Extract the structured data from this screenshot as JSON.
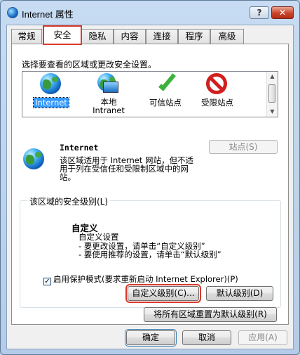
{
  "window": {
    "title": "Internet 属性"
  },
  "titlebar": {
    "help_label": "?",
    "close_label": "✕"
  },
  "tabs": [
    {
      "label": "常规"
    },
    {
      "label": "安全"
    },
    {
      "label": "隐私"
    },
    {
      "label": "内容"
    },
    {
      "label": "连接"
    },
    {
      "label": "程序"
    },
    {
      "label": "高级"
    }
  ],
  "active_tab": "安全",
  "security": {
    "instruction": "选择要查看的区域或更改安全设置。",
    "zones": [
      {
        "label": "Internet",
        "label2": "",
        "icon": "globe-icon",
        "selected": true
      },
      {
        "label": "本地",
        "label2": "Intranet",
        "icon": "local-intranet-icon",
        "selected": false
      },
      {
        "label": "可信站点",
        "label2": "",
        "icon": "checkmark-icon",
        "selected": false
      },
      {
        "label": "受限站点",
        "label2": "",
        "icon": "no-entry-icon",
        "selected": false
      }
    ],
    "zone_name": "Internet",
    "zone_description": "该区域适用于 Internet 网站，但不适用于列在受信任和受限制区域中的网站。",
    "sites_button": "站点(S)",
    "group_title": "该区域的安全级别(L)",
    "level_name": "自定义",
    "level_lines": [
      "自定义设置",
      "- 要更改设置，请单击“自定义级别”",
      "- 要使用推荐的设置，请单击“默认级别”"
    ],
    "protected_mode_label": "启用保护模式(要求重新启动 Internet Explorer)(P)",
    "protected_mode_checked": true,
    "custom_level_button": "自定义级别(C)...",
    "default_level_button": "默认级别(D)",
    "reset_all_button": "将所有区域重置为默认级别(R)"
  },
  "footer": {
    "ok": "确定",
    "cancel": "取消",
    "apply": "应用(A)"
  },
  "colors": {
    "highlight_box": "#d83a2e",
    "selection": "#3399ff"
  }
}
